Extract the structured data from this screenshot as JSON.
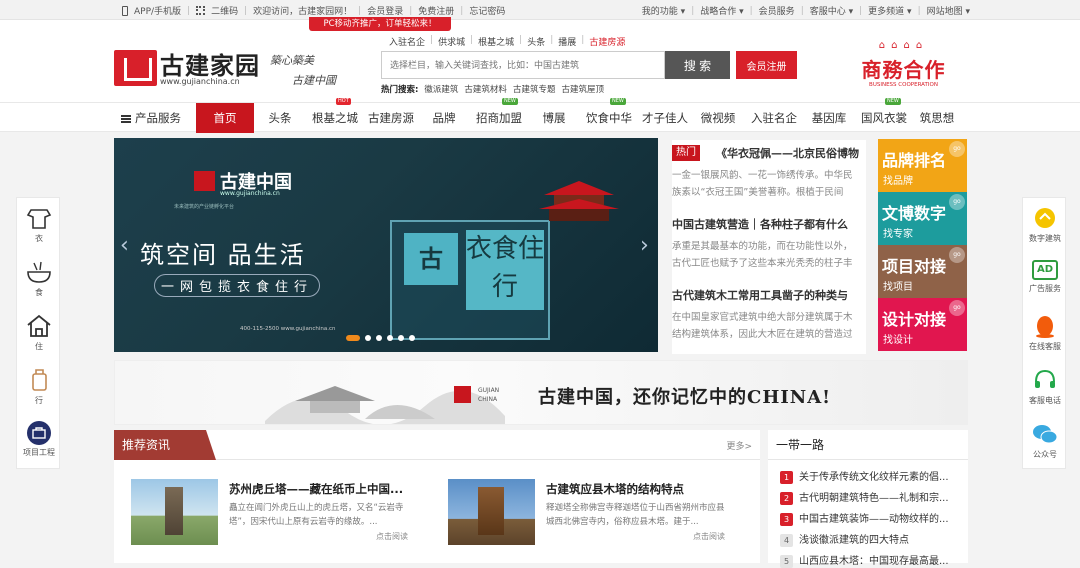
{
  "topbar": {
    "left": [
      "APP/手机版",
      "二维码",
      "欢迎访问，古建家园网！",
      "会员登录",
      "免费注册",
      "忘记密码"
    ],
    "right": [
      "我的功能 ▾",
      "战略合作 ▾",
      "会员服务",
      "客服中心 ▾",
      "更多频道 ▾",
      "网站地图 ▾"
    ]
  },
  "promo": "PC移动齐推广，订单轻松来！",
  "header": {
    "logo_text": "古建家园",
    "logo_url": "www.gujianchina.cn",
    "slogan1": "築心築美",
    "slogan2": "古建中國",
    "search_tabs": [
      "入驻名企",
      "供求城",
      "根基之城",
      "头条",
      "播展",
      "古建房源"
    ],
    "search_placeholder": "选择栏目，输入关键词查找，比如：中国古建筑",
    "search_button": "搜 索",
    "register_button": "会员注册",
    "hot_label": "热门搜索:",
    "hot_terms": [
      "徽派建筑",
      "古建筑材料",
      "古建筑专题",
      "古建筑屋顶"
    ],
    "biz_big": "商務合作",
    "biz_en": "BUSINESS COOPERATION"
  },
  "nav": {
    "items": [
      "产品服务",
      "首页",
      "头条",
      "根基之城",
      "古建房源",
      "品牌",
      "招商加盟",
      "博展",
      "饮食中华",
      "才子佳人",
      "微视频",
      "入驻名企",
      "基因库",
      "国风衣裳",
      "筑思想"
    ],
    "badge_hot": "HOT",
    "badge_new": "NEW"
  },
  "banner": {
    "brand": "古建中国",
    "url": "www.gujianchina.cn",
    "tagline": "未来建筑的产业链孵化平台",
    "headline": "筑空间 品生活",
    "sub": "一网包揽衣食住行",
    "box_text": "衣食住行",
    "phone": "400-115-2500  www.gujianchina.cn"
  },
  "hot": {
    "badge": "热门",
    "items": [
      {
        "title": "《华衣冠佩——北京民俗博物",
        "desc": [
          "一金一银展风韵、一花一饰绣传承。中华民",
          "族素以“衣冠王国”美誉著称。根植于民间"
        ]
      },
      {
        "title": "中国古建筑营造｜各种柱子都有什么",
        "desc": [
          "承重是其最基本的功能，而在功能性以外，",
          "古代工匠也赋予了这些本来光秃秃的柱子丰"
        ]
      },
      {
        "title": "古代建筑木工常用工具凿子的种类与",
        "desc": [
          "在中国皇家官式建筑中绝大部分建筑属于木",
          "结构建筑体系，因此大木匠在建筑的营造过"
        ]
      }
    ]
  },
  "tiles": [
    {
      "big": "品牌排名",
      "small": "找品牌",
      "color": "#f2a516"
    },
    {
      "big": "文博数字",
      "small": "找专家",
      "color": "#1d9c9d"
    },
    {
      "big": "项目对接",
      "small": "找项目",
      "color": "#8f6248"
    },
    {
      "big": "设计对接",
      "small": "找设计",
      "color": "#e1164f"
    }
  ],
  "tile_go": "go",
  "strip": {
    "en": [
      "GUJIAN",
      "CHINA"
    ],
    "text": "古建中国，还你记忆中的CHINA!"
  },
  "rec": {
    "title": "推荐资讯",
    "more": "更多>",
    "articles": [
      {
        "title": "苏州虎丘塔——藏在纸币上中国...",
        "desc": "矗立在阊门外虎丘山上的虎丘塔，又名“云岩寺塔”，因宋代山上原有云岩寺的缘故。...",
        "read": "点击阅读"
      },
      {
        "title": "古建筑应县木塔的结构特点",
        "desc": "释迦塔全称佛宫寺释迦塔位于山西省朔州市应县城西北佛宫寺内，俗称应县木塔。建于...",
        "read": "点击阅读"
      }
    ]
  },
  "belt": {
    "title": "一带一路",
    "items": [
      {
        "n": "1",
        "text": "关于传承传统文化纹样元素的倡..."
      },
      {
        "n": "2",
        "text": "古代明朝建筑特色——礼制和宗..."
      },
      {
        "n": "3",
        "text": "中国古建筑装饰——动物纹样的..."
      },
      {
        "n": "4",
        "text": "浅谈徽派建筑的四大特点"
      },
      {
        "n": "5",
        "text": "山西应县木塔：中国现存最高最..."
      }
    ]
  },
  "side_left": [
    "衣",
    "食",
    "住",
    "行",
    "项目工程"
  ],
  "side_right": [
    "数字建筑",
    "广告服务",
    "在线客服",
    "客服电话",
    "公众号"
  ],
  "side_right_ad": "AD",
  "banner_logo2": "古"
}
